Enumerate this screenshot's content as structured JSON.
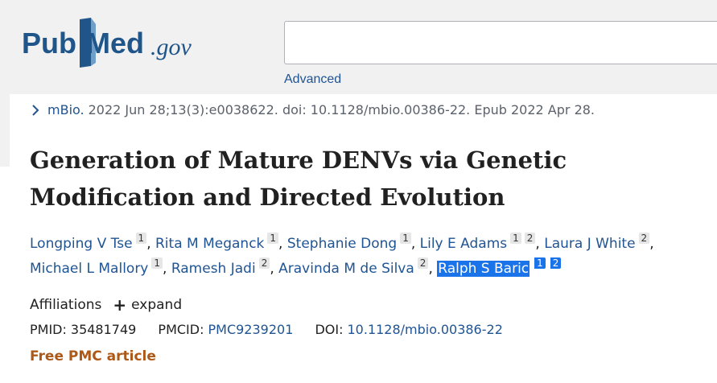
{
  "header": {
    "logo_pub": "Pub",
    "logo_med": "Med",
    "logo_gov": ".gov",
    "search_value": "",
    "advanced_label": "Advanced"
  },
  "citation": {
    "journal": "mBio.",
    "text": "2022 Jun 28;13(3):e0038622. doi: 10.1128/mbio.00386-22. Epub 2022 Apr 28."
  },
  "article": {
    "title": "Generation of Mature DENVs via Genetic Modification and Directed Evolution"
  },
  "authors": [
    {
      "name": "Longping V Tse",
      "affs": [
        "1"
      ]
    },
    {
      "name": "Rita M Meganck",
      "affs": [
        "1"
      ]
    },
    {
      "name": "Stephanie Dong",
      "affs": [
        "1"
      ]
    },
    {
      "name": "Lily E Adams",
      "affs": [
        "1",
        "2"
      ]
    },
    {
      "name": "Laura J White",
      "affs": [
        "2"
      ]
    },
    {
      "name": "Michael L Mallory",
      "affs": [
        "1"
      ]
    },
    {
      "name": "Ramesh Jadi",
      "affs": [
        "2"
      ]
    },
    {
      "name": "Aravinda M de Silva",
      "affs": [
        "2"
      ]
    },
    {
      "name": "Ralph S Baric",
      "affs": [
        "1",
        "2"
      ]
    }
  ],
  "affiliations": {
    "label": "Affiliations",
    "expand_label": "expand"
  },
  "ids": {
    "pmid_label": "PMID:",
    "pmid": "35481749",
    "pmcid_label": "PMCID:",
    "pmcid": "PMC9239201",
    "doi_label": "DOI:",
    "doi": "10.1128/mbio.00386-22"
  },
  "free_pmc": "Free PMC article",
  "colors": {
    "link": "#205493",
    "free_pmc": "#ae5817",
    "selection": "#1a73e8"
  }
}
